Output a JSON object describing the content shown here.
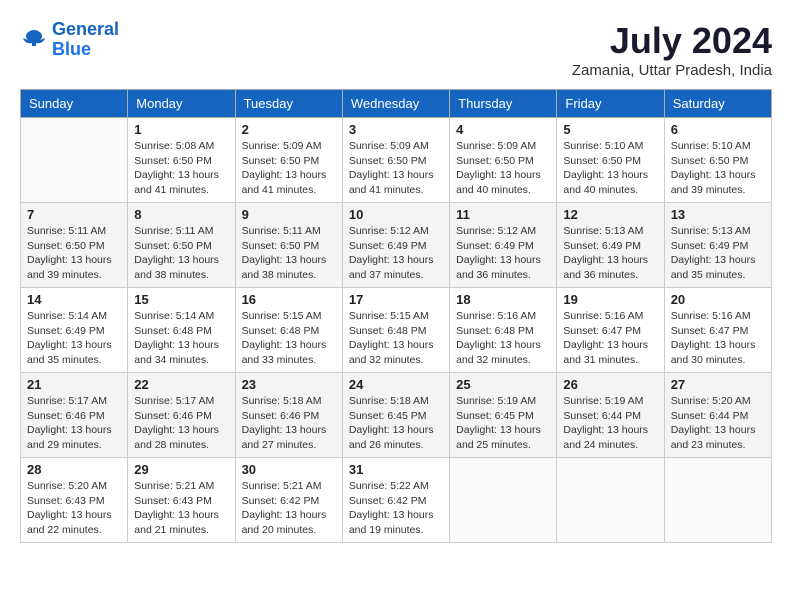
{
  "header": {
    "logo_line1": "General",
    "logo_line2": "Blue",
    "month_year": "July 2024",
    "location": "Zamania, Uttar Pradesh, India"
  },
  "columns": [
    "Sunday",
    "Monday",
    "Tuesday",
    "Wednesday",
    "Thursday",
    "Friday",
    "Saturday"
  ],
  "weeks": [
    [
      {
        "day": "",
        "info": ""
      },
      {
        "day": "1",
        "info": "Sunrise: 5:08 AM\nSunset: 6:50 PM\nDaylight: 13 hours\nand 41 minutes."
      },
      {
        "day": "2",
        "info": "Sunrise: 5:09 AM\nSunset: 6:50 PM\nDaylight: 13 hours\nand 41 minutes."
      },
      {
        "day": "3",
        "info": "Sunrise: 5:09 AM\nSunset: 6:50 PM\nDaylight: 13 hours\nand 41 minutes."
      },
      {
        "day": "4",
        "info": "Sunrise: 5:09 AM\nSunset: 6:50 PM\nDaylight: 13 hours\nand 40 minutes."
      },
      {
        "day": "5",
        "info": "Sunrise: 5:10 AM\nSunset: 6:50 PM\nDaylight: 13 hours\nand 40 minutes."
      },
      {
        "day": "6",
        "info": "Sunrise: 5:10 AM\nSunset: 6:50 PM\nDaylight: 13 hours\nand 39 minutes."
      }
    ],
    [
      {
        "day": "7",
        "info": "Sunrise: 5:11 AM\nSunset: 6:50 PM\nDaylight: 13 hours\nand 39 minutes."
      },
      {
        "day": "8",
        "info": "Sunrise: 5:11 AM\nSunset: 6:50 PM\nDaylight: 13 hours\nand 38 minutes."
      },
      {
        "day": "9",
        "info": "Sunrise: 5:11 AM\nSunset: 6:50 PM\nDaylight: 13 hours\nand 38 minutes."
      },
      {
        "day": "10",
        "info": "Sunrise: 5:12 AM\nSunset: 6:49 PM\nDaylight: 13 hours\nand 37 minutes."
      },
      {
        "day": "11",
        "info": "Sunrise: 5:12 AM\nSunset: 6:49 PM\nDaylight: 13 hours\nand 36 minutes."
      },
      {
        "day": "12",
        "info": "Sunrise: 5:13 AM\nSunset: 6:49 PM\nDaylight: 13 hours\nand 36 minutes."
      },
      {
        "day": "13",
        "info": "Sunrise: 5:13 AM\nSunset: 6:49 PM\nDaylight: 13 hours\nand 35 minutes."
      }
    ],
    [
      {
        "day": "14",
        "info": "Sunrise: 5:14 AM\nSunset: 6:49 PM\nDaylight: 13 hours\nand 35 minutes."
      },
      {
        "day": "15",
        "info": "Sunrise: 5:14 AM\nSunset: 6:48 PM\nDaylight: 13 hours\nand 34 minutes."
      },
      {
        "day": "16",
        "info": "Sunrise: 5:15 AM\nSunset: 6:48 PM\nDaylight: 13 hours\nand 33 minutes."
      },
      {
        "day": "17",
        "info": "Sunrise: 5:15 AM\nSunset: 6:48 PM\nDaylight: 13 hours\nand 32 minutes."
      },
      {
        "day": "18",
        "info": "Sunrise: 5:16 AM\nSunset: 6:48 PM\nDaylight: 13 hours\nand 32 minutes."
      },
      {
        "day": "19",
        "info": "Sunrise: 5:16 AM\nSunset: 6:47 PM\nDaylight: 13 hours\nand 31 minutes."
      },
      {
        "day": "20",
        "info": "Sunrise: 5:16 AM\nSunset: 6:47 PM\nDaylight: 13 hours\nand 30 minutes."
      }
    ],
    [
      {
        "day": "21",
        "info": "Sunrise: 5:17 AM\nSunset: 6:46 PM\nDaylight: 13 hours\nand 29 minutes."
      },
      {
        "day": "22",
        "info": "Sunrise: 5:17 AM\nSunset: 6:46 PM\nDaylight: 13 hours\nand 28 minutes."
      },
      {
        "day": "23",
        "info": "Sunrise: 5:18 AM\nSunset: 6:46 PM\nDaylight: 13 hours\nand 27 minutes."
      },
      {
        "day": "24",
        "info": "Sunrise: 5:18 AM\nSunset: 6:45 PM\nDaylight: 13 hours\nand 26 minutes."
      },
      {
        "day": "25",
        "info": "Sunrise: 5:19 AM\nSunset: 6:45 PM\nDaylight: 13 hours\nand 25 minutes."
      },
      {
        "day": "26",
        "info": "Sunrise: 5:19 AM\nSunset: 6:44 PM\nDaylight: 13 hours\nand 24 minutes."
      },
      {
        "day": "27",
        "info": "Sunrise: 5:20 AM\nSunset: 6:44 PM\nDaylight: 13 hours\nand 23 minutes."
      }
    ],
    [
      {
        "day": "28",
        "info": "Sunrise: 5:20 AM\nSunset: 6:43 PM\nDaylight: 13 hours\nand 22 minutes."
      },
      {
        "day": "29",
        "info": "Sunrise: 5:21 AM\nSunset: 6:43 PM\nDaylight: 13 hours\nand 21 minutes."
      },
      {
        "day": "30",
        "info": "Sunrise: 5:21 AM\nSunset: 6:42 PM\nDaylight: 13 hours\nand 20 minutes."
      },
      {
        "day": "31",
        "info": "Sunrise: 5:22 AM\nSunset: 6:42 PM\nDaylight: 13 hours\nand 19 minutes."
      },
      {
        "day": "",
        "info": ""
      },
      {
        "day": "",
        "info": ""
      },
      {
        "day": "",
        "info": ""
      }
    ]
  ]
}
